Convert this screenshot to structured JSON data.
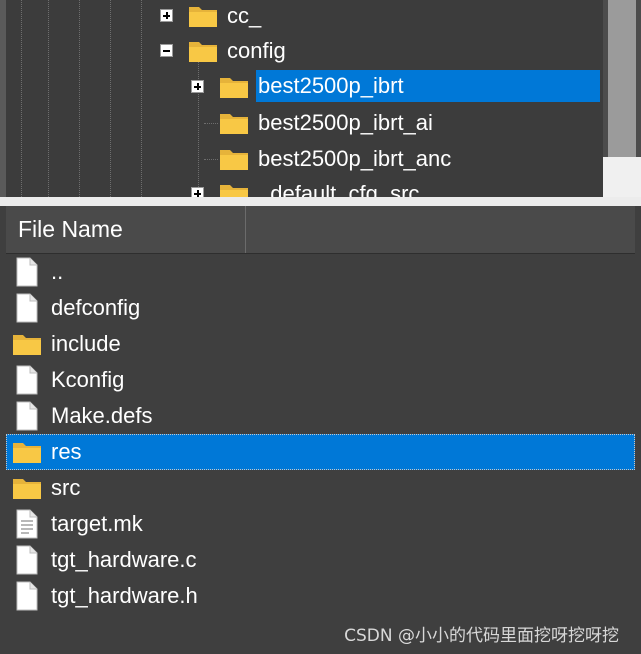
{
  "tree": {
    "nodes": [
      {
        "label": "cc_",
        "icon": "folder-icon",
        "expander": "plus"
      },
      {
        "label": "config",
        "icon": "folder-icon",
        "expander": "minus"
      },
      {
        "label": "best2500p_ibrt",
        "icon": "folder-icon",
        "expander": "plus",
        "selected": true
      },
      {
        "label": "best2500p_ibrt_ai",
        "icon": "folder-icon",
        "expander": "none"
      },
      {
        "label": "best2500p_ibrt_anc",
        "icon": "folder-icon",
        "expander": "none"
      },
      {
        "label": "_default_cfg_src",
        "icon": "folder-icon",
        "expander": "plus"
      }
    ]
  },
  "file_list": {
    "column_header": "File Name",
    "rows": [
      {
        "name": "..",
        "icon": "blank-file-icon"
      },
      {
        "name": "defconfig",
        "icon": "blank-file-icon"
      },
      {
        "name": "include",
        "icon": "folder-icon"
      },
      {
        "name": "Kconfig",
        "icon": "blank-file-icon"
      },
      {
        "name": "Make.defs",
        "icon": "blank-file-icon"
      },
      {
        "name": "res",
        "icon": "folder-icon",
        "selected": true
      },
      {
        "name": "src",
        "icon": "folder-icon"
      },
      {
        "name": "target.mk",
        "icon": "text-file-icon"
      },
      {
        "name": "tgt_hardware.c",
        "icon": "blank-file-icon"
      },
      {
        "name": "tgt_hardware.h",
        "icon": "blank-file-icon"
      }
    ]
  },
  "watermark": "CSDN @小小的代码里面挖呀挖呀挖",
  "colors": {
    "background": "#3f3f3f",
    "selection": "#0078d7",
    "folder": "#f8c845",
    "text": "#ffffff"
  }
}
